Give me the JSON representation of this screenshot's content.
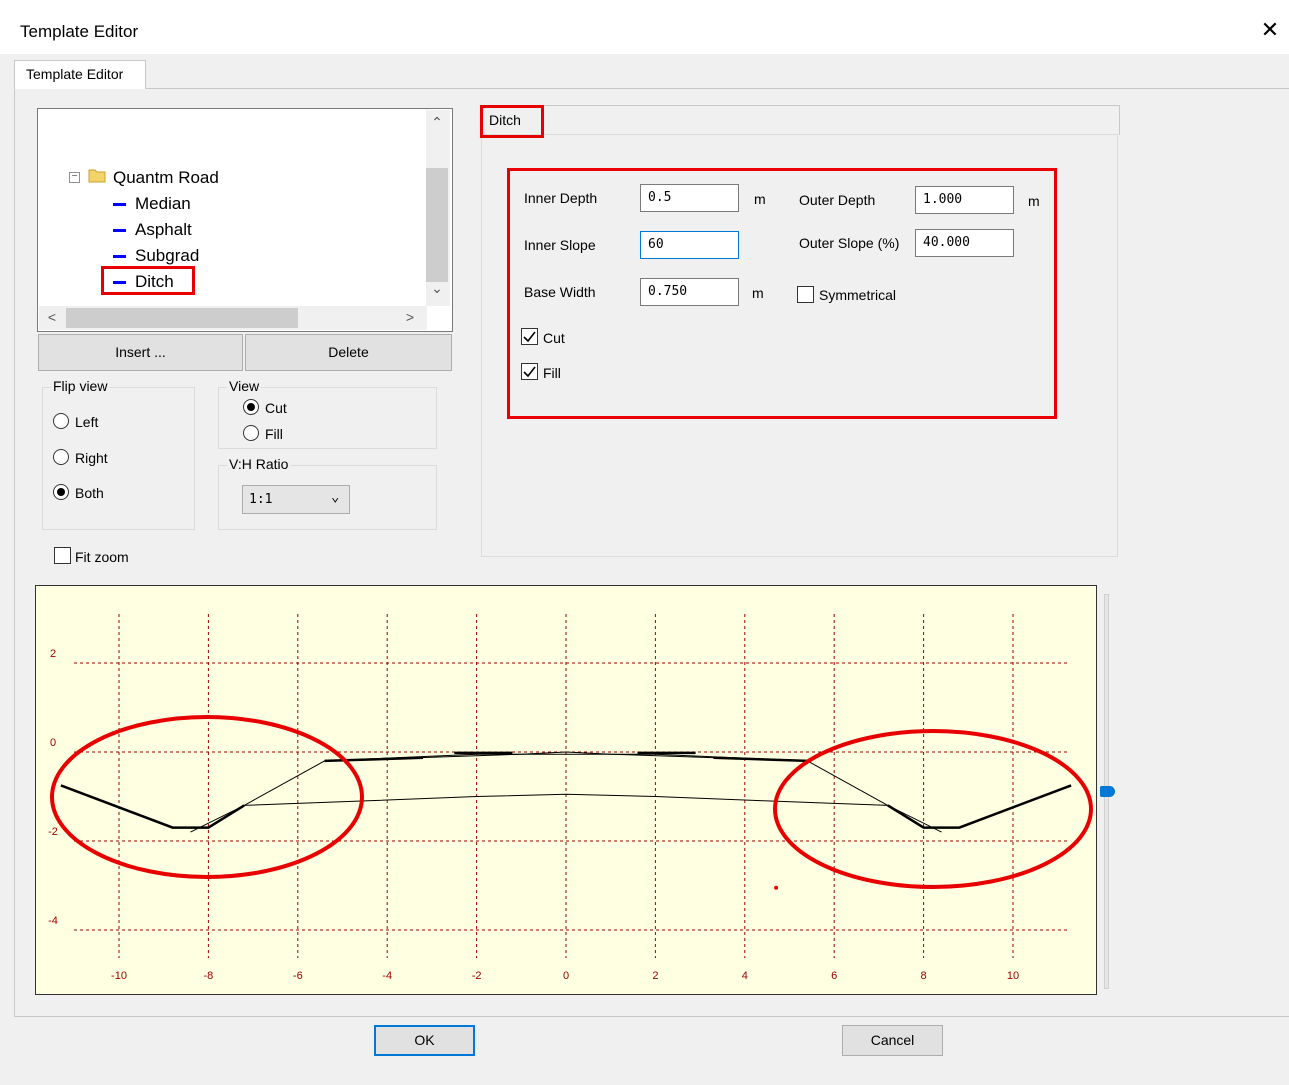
{
  "window": {
    "title": "Template Editor",
    "close_glyph": "✕"
  },
  "tabs": {
    "main": "Template Editor",
    "ditch": "Ditch"
  },
  "tree": {
    "root": "Quantm Road",
    "expander_glyph": "−",
    "items": [
      {
        "label": "Median"
      },
      {
        "label": "Asphalt"
      },
      {
        "label": "Subgrad"
      },
      {
        "label": "Ditch"
      }
    ],
    "scroll_up": "⌃",
    "scroll_down": "⌄",
    "scroll_left": "<",
    "scroll_right": ">"
  },
  "buttons": {
    "insert": "Insert ...",
    "delete": "Delete",
    "ok": "OK",
    "cancel": "Cancel"
  },
  "flip_view": {
    "legend": "Flip view",
    "options": [
      "Left",
      "Right",
      "Both"
    ],
    "selected": "Both"
  },
  "view": {
    "legend": "View",
    "options": [
      "Cut",
      "Fill"
    ],
    "selected": "Cut"
  },
  "vh_ratio": {
    "legend": "V:H Ratio",
    "value": "1:1",
    "dropdown_glyph": "⌄"
  },
  "fit_zoom": {
    "label": "Fit zoom",
    "checked": false
  },
  "ditch": {
    "inner_depth": {
      "label": "Inner Depth",
      "value": "0.5",
      "unit": "m"
    },
    "outer_depth": {
      "label": "Outer Depth",
      "value": "1.000",
      "unit": "m"
    },
    "inner_slope": {
      "label": "Inner Slope",
      "value": "60"
    },
    "outer_slope": {
      "label": "Outer Slope (%)",
      "value": "40.000"
    },
    "base_width": {
      "label": "Base Width",
      "value": "0.750",
      "unit": "m"
    },
    "symmetrical": {
      "label": "Symmetrical",
      "checked": false
    },
    "cut": {
      "label": "Cut",
      "checked": true
    },
    "fill": {
      "label": "Fill",
      "checked": true
    }
  },
  "colors": {
    "highlight": "#e80000",
    "chart_bg": "#ffffe1",
    "grid": "#a00000",
    "tree_dash": "#0000ff",
    "accent": "#0078d7"
  },
  "icons": {
    "folder": "folder-icon",
    "close": "close-icon",
    "check": "checkmark-icon"
  },
  "chart_data": {
    "type": "line",
    "title": "",
    "xlabel": "",
    "ylabel": "",
    "xlim": [
      -11.5,
      11.5
    ],
    "ylim": [
      -5.5,
      3.5
    ],
    "x_ticks": [
      -10,
      -8,
      -6,
      -4,
      -2,
      0,
      2,
      4,
      6,
      8,
      10
    ],
    "y_ticks": [
      2,
      0,
      -2,
      -4
    ],
    "grid": true,
    "series": [
      {
        "style": "thin",
        "points": [
          [
            -8.4,
            -1.8
          ],
          [
            -7.2,
            -1.2
          ],
          [
            -5.4,
            -0.2
          ],
          [
            -1.0,
            -0.05
          ],
          [
            0,
            0
          ],
          [
            1.0,
            -0.05
          ],
          [
            5.4,
            -0.2
          ],
          [
            7.2,
            -1.2
          ],
          [
            8.4,
            -1.8
          ]
        ]
      },
      {
        "style": "thin",
        "points": [
          [
            -7.2,
            -1.2
          ],
          [
            -4.5,
            -1.1
          ],
          [
            -2,
            -1.0
          ],
          [
            0,
            -0.95
          ],
          [
            2,
            -1.0
          ],
          [
            4.5,
            -1.1
          ],
          [
            7.2,
            -1.2
          ]
        ]
      },
      {
        "style": "thin",
        "points": [
          [
            -5.4,
            -0.2
          ],
          [
            -2,
            -0.05
          ],
          [
            2,
            -0.05
          ],
          [
            5.4,
            -0.2
          ]
        ]
      },
      {
        "style": "thick",
        "points": [
          [
            -11.3,
            -0.75
          ],
          [
            -8.8,
            -1.7
          ],
          [
            -8.0,
            -1.7
          ],
          [
            -7.2,
            -1.2
          ]
        ]
      },
      {
        "style": "thick",
        "points": [
          [
            7.2,
            -1.2
          ],
          [
            8.0,
            -1.7
          ],
          [
            8.8,
            -1.7
          ],
          [
            11.3,
            -0.75
          ]
        ]
      },
      {
        "style": "thick",
        "points": [
          [
            -5.4,
            -0.2
          ],
          [
            -3.2,
            -0.13
          ]
        ]
      },
      {
        "style": "thick",
        "points": [
          [
            -2.5,
            -0.02
          ],
          [
            -1.2,
            -0.02
          ]
        ]
      },
      {
        "style": "thick",
        "points": [
          [
            1.6,
            -0.02
          ],
          [
            2.9,
            -0.02
          ]
        ]
      },
      {
        "style": "thick",
        "points": [
          [
            3.3,
            -0.13
          ],
          [
            5.4,
            -0.2
          ]
        ]
      }
    ],
    "marker": {
      "x": 4.7,
      "y": -3.05
    }
  }
}
